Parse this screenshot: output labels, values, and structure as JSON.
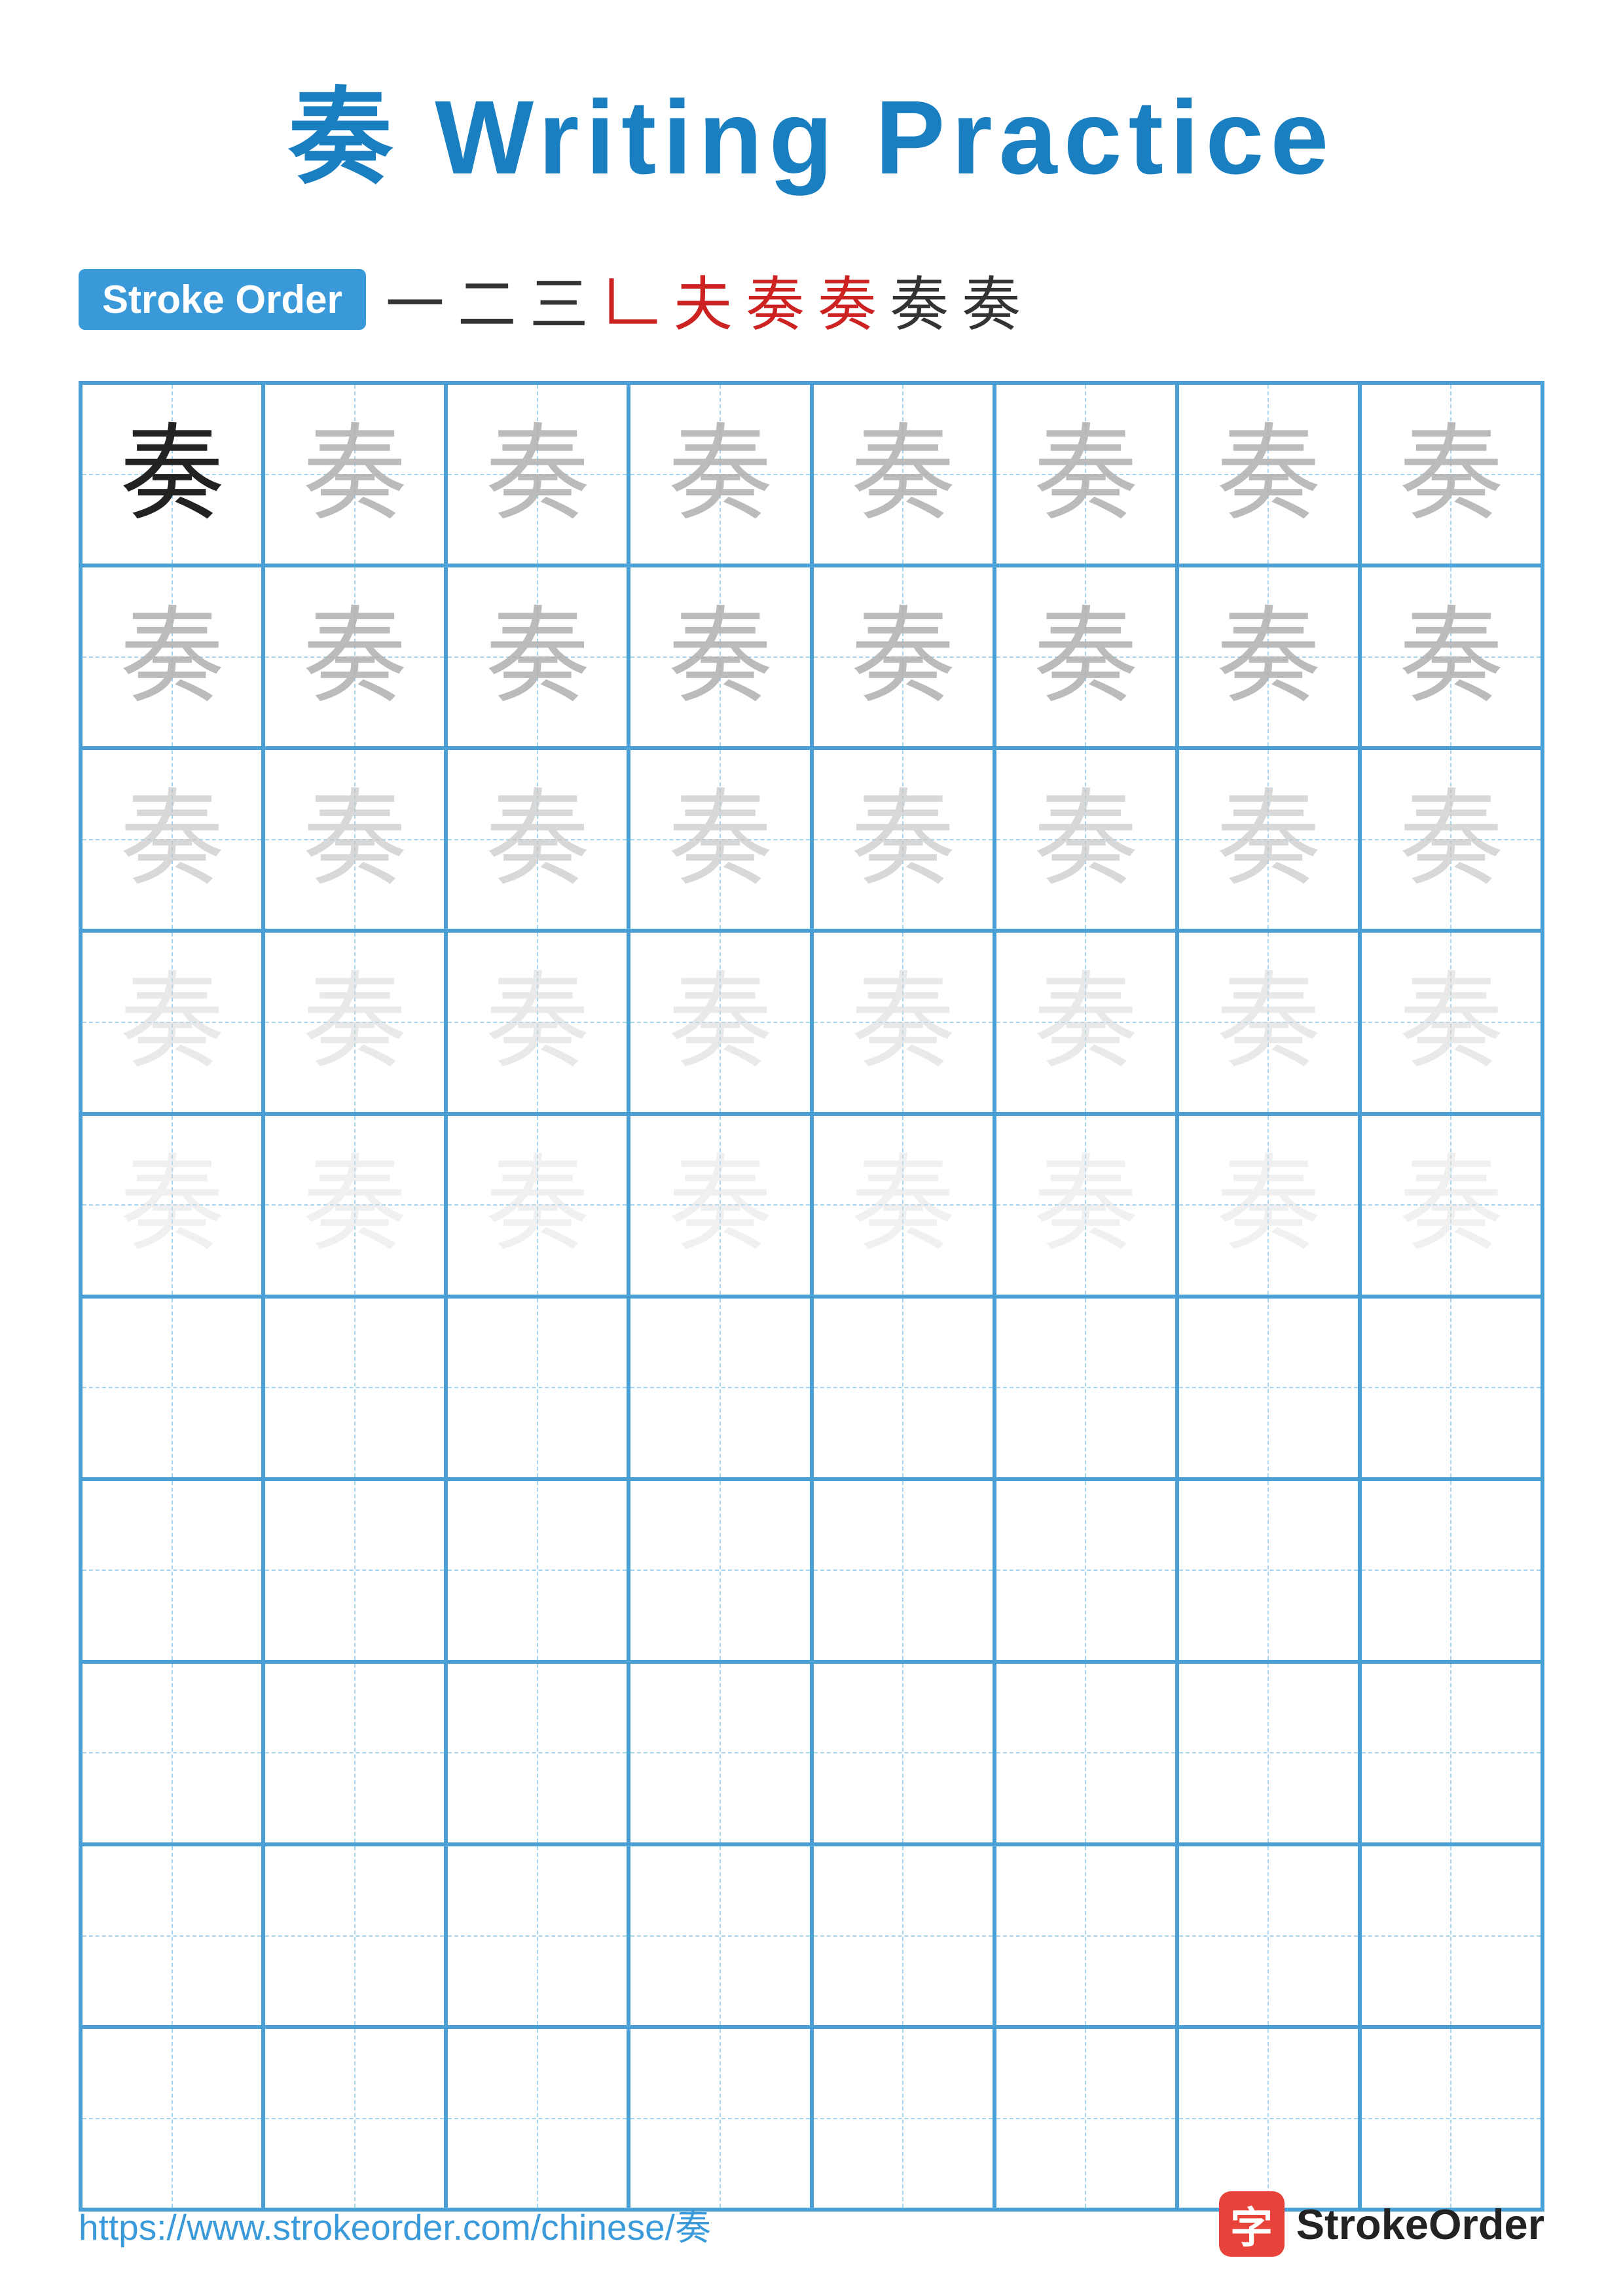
{
  "title": {
    "char": "奏",
    "rest": " Writing Practice"
  },
  "stroke_order": {
    "badge_label": "Stroke Order",
    "strokes": [
      "一",
      "二",
      "三",
      "𠃊",
      "夫",
      "奏",
      "奏",
      "奏",
      "奏"
    ],
    "stroke_colors": [
      "black",
      "black",
      "black",
      "red",
      "red",
      "red",
      "red",
      "black",
      "black"
    ]
  },
  "grid": {
    "rows": 10,
    "cols": 8,
    "practice_char": "奏",
    "filled_rows": 5,
    "shading_levels": [
      "dark",
      "light1",
      "light1",
      "light2",
      "light2",
      "light3",
      "light3",
      "light4",
      "light4"
    ]
  },
  "footer": {
    "url": "https://www.strokeorder.com/chinese/奏",
    "logo_char": "字",
    "logo_name": "StrokeOrder"
  }
}
